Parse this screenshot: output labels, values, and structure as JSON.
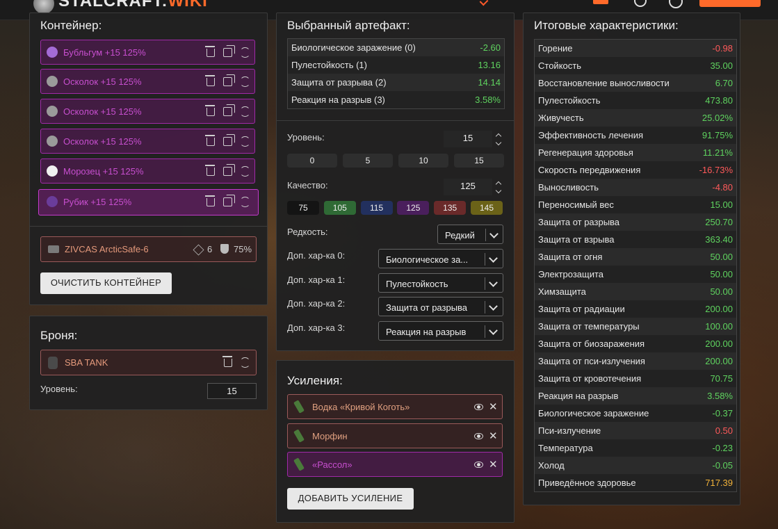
{
  "topbar": {
    "logo_text_main": "STALCRAFT:",
    "logo_text_accent": "WIKI"
  },
  "container": {
    "title": "Контейнер:",
    "slots": [
      {
        "label": "Бубльгум +15 125%",
        "icon": "bubblegum-icon",
        "color": "#a46bd6"
      },
      {
        "label": "Осколок +15 125%",
        "icon": "shard-icon",
        "color": "#9a9a9a"
      },
      {
        "label": "Осколок +15 125%",
        "icon": "shard-icon",
        "color": "#9a9a9a"
      },
      {
        "label": "Осколок +15 125%",
        "icon": "shard-icon",
        "color": "#9a9a9a"
      },
      {
        "label": "Морозец +15 125%",
        "icon": "frost-icon",
        "color": "#f0f0f0"
      },
      {
        "label": "Рубик +15 125%",
        "icon": "rubik-icon",
        "color": "#6a3c9a"
      }
    ],
    "item_name": "ZIVCAS ArcticSafe-6",
    "item_slots": "6",
    "item_protection": "75%",
    "clear_button": "ОЧИСТИТЬ КОНТЕЙНЕР"
  },
  "armor": {
    "title": "Броня:",
    "item_name": "SBA TANK",
    "level_label": "Уровень:",
    "level_value": "15"
  },
  "artifact": {
    "title": "Выбранный артефакт:",
    "stats": [
      {
        "name": "Биологическое заражение (0)",
        "value": "-2.60"
      },
      {
        "name": "Пулестойкость (1)",
        "value": "13.16"
      },
      {
        "name": "Защита от разрыва (2)",
        "value": "14.14"
      },
      {
        "name": "Реакция на разрыв (3)",
        "value": "3.58%"
      }
    ],
    "level_label": "Уровень:",
    "level_value": "15",
    "level_presets": [
      "0",
      "5",
      "10",
      "15"
    ],
    "quality_label": "Качество:",
    "quality_value": "125",
    "quality_presets": [
      {
        "label": "75",
        "color": "#141414"
      },
      {
        "label": "105",
        "color": "#2f6a35"
      },
      {
        "label": "115",
        "color": "#22305e"
      },
      {
        "label": "125",
        "color": "#4a1f5c"
      },
      {
        "label": "135",
        "color": "#6a2a2a"
      },
      {
        "label": "145",
        "color": "#6b6218"
      }
    ],
    "rarity_label": "Редкость:",
    "rarity_value": "Редкий",
    "extra": [
      {
        "label": "Доп. хар-ка 0:",
        "value": "Биологическое за..."
      },
      {
        "label": "Доп. хар-ка 1:",
        "value": "Пулестойкость"
      },
      {
        "label": "Доп. хар-ка 2:",
        "value": "Защита от разрыва"
      },
      {
        "label": "Доп. хар-ка 3:",
        "value": "Реакция на разрыв"
      }
    ]
  },
  "boosts": {
    "title": "Усиления:",
    "items": [
      {
        "label": "Водка «Кривой Коготь»",
        "color": "#e0a080",
        "border": "#9b5a5a",
        "bg": "rgba(70,35,35,0.5)",
        "icon": "bottle-icon"
      },
      {
        "label": "Морфин",
        "color": "#e0a080",
        "border": "#9b5a5a",
        "bg": "rgba(70,35,35,0.5)",
        "icon": "syringe-icon"
      },
      {
        "label": "«Рассол»",
        "color": "#c84fd0",
        "border": "#a02aa8",
        "bg": "rgba(95,25,95,0.55)",
        "icon": "jar-icon"
      }
    ],
    "add_button": "ДОБАВИТЬ УСИЛЕНИЕ"
  },
  "totals": {
    "title": "Итоговые характеристики:",
    "rows": [
      {
        "name": "Горение",
        "value": "-0.98",
        "tone": "r"
      },
      {
        "name": "Стойкость",
        "value": "35.00",
        "tone": "g"
      },
      {
        "name": "Восстановление выносливости",
        "value": "6.70",
        "tone": "g"
      },
      {
        "name": "Пулестойкость",
        "value": "473.80",
        "tone": "g"
      },
      {
        "name": "Живучесть",
        "value": "25.02%",
        "tone": "g"
      },
      {
        "name": "Эффективность лечения",
        "value": "91.75%",
        "tone": "g"
      },
      {
        "name": "Регенерация здоровья",
        "value": "11.21%",
        "tone": "g"
      },
      {
        "name": "Скорость передвижения",
        "value": "-16.73%",
        "tone": "r"
      },
      {
        "name": "Выносливость",
        "value": "-4.80",
        "tone": "r"
      },
      {
        "name": "Переносимый вес",
        "value": "15.00",
        "tone": "g"
      },
      {
        "name": "Защита от разрыва",
        "value": "250.70",
        "tone": "g"
      },
      {
        "name": "Защита от взрыва",
        "value": "363.40",
        "tone": "g"
      },
      {
        "name": "Защита от огня",
        "value": "50.00",
        "tone": "g"
      },
      {
        "name": "Электрозащита",
        "value": "50.00",
        "tone": "g"
      },
      {
        "name": "Химзащита",
        "value": "50.00",
        "tone": "g"
      },
      {
        "name": "Защита от радиации",
        "value": "200.00",
        "tone": "g"
      },
      {
        "name": "Защита от температуры",
        "value": "100.00",
        "tone": "g"
      },
      {
        "name": "Защита от биозаражения",
        "value": "200.00",
        "tone": "g"
      },
      {
        "name": "Защита от пси-излучения",
        "value": "200.00",
        "tone": "g"
      },
      {
        "name": "Защита от кровотечения",
        "value": "70.75",
        "tone": "g"
      },
      {
        "name": "Реакция на разрыв",
        "value": "3.58%",
        "tone": "g"
      },
      {
        "name": "Биологическое заражение",
        "value": "-0.37",
        "tone": "g"
      },
      {
        "name": "Пси-излучение",
        "value": "0.50",
        "tone": "r"
      },
      {
        "name": "Температура",
        "value": "-0.23",
        "tone": "g"
      },
      {
        "name": "Холод",
        "value": "-0.05",
        "tone": "g"
      },
      {
        "name": "Приведённое здоровье",
        "value": "717.39",
        "tone": "o"
      }
    ]
  }
}
